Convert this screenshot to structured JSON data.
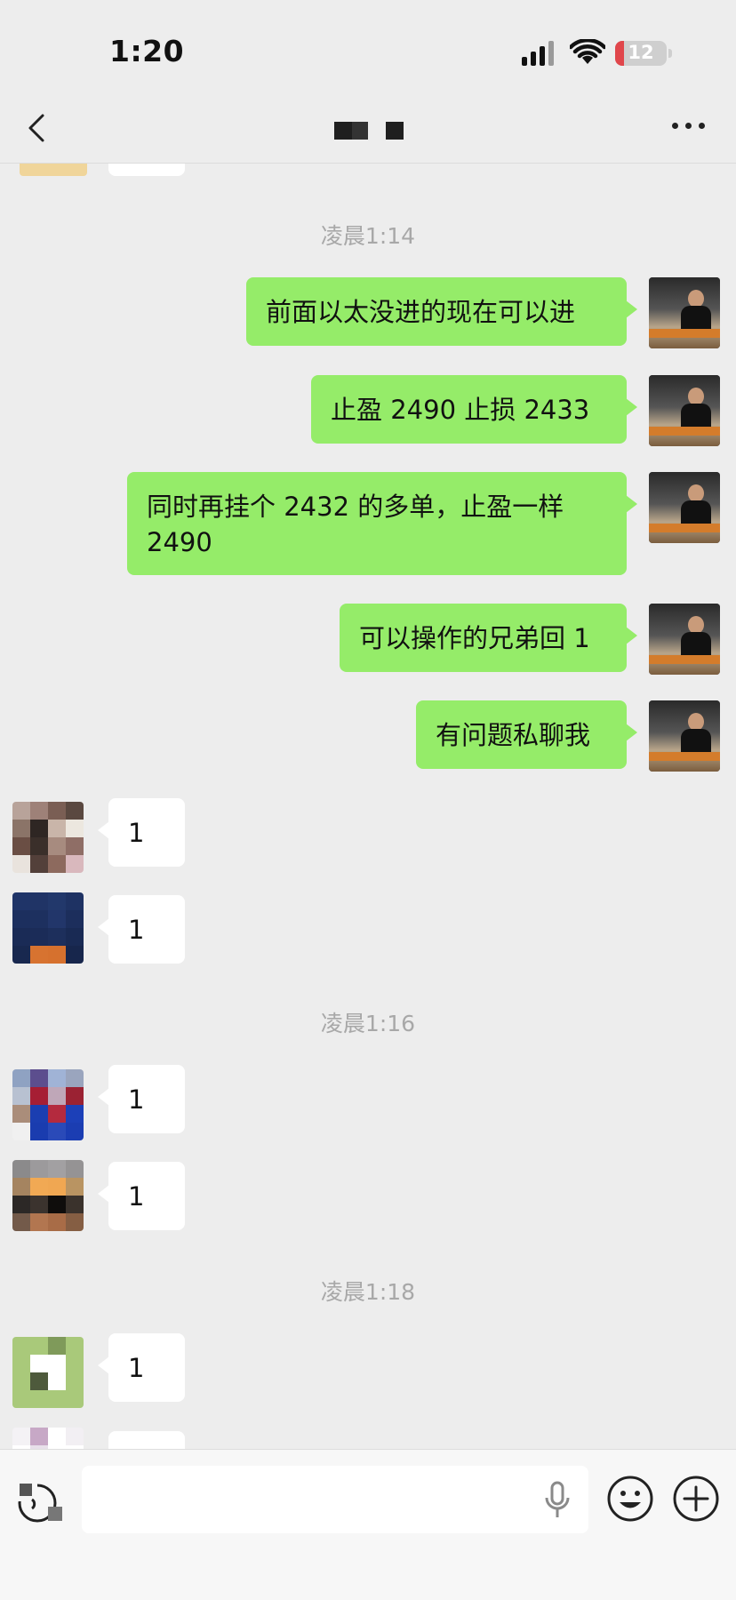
{
  "status_bar": {
    "time": "1:20",
    "battery": "12",
    "battery_color": "#e0464b"
  },
  "nav": {
    "back_icon": "chevron-left-icon",
    "more_icon": "more-horizontal-icon"
  },
  "colors": {
    "outgoing_bubble": "#95ec69",
    "incoming_bubble": "#ffffff",
    "background": "#ededed"
  },
  "timestamps": [
    "凌晨1:14",
    "凌晨1:16",
    "凌晨1:18"
  ],
  "outgoing_messages": [
    "前面以太没进的现在可以进",
    "止盈 2490 止损 2433",
    "同时再挂个 2432 的多单，止盈一样 2490",
    "可以操作的兄弟回 1",
    "有问题私聊我"
  ],
  "incoming_messages": [
    "1",
    "1",
    "1",
    "1",
    "1"
  ],
  "input_bar": {
    "placeholder": "",
    "voice_icon": "voice-icon",
    "mic_icon": "mic-icon",
    "emoji_icon": "emoji-icon",
    "plus_icon": "plus-circle-icon"
  }
}
